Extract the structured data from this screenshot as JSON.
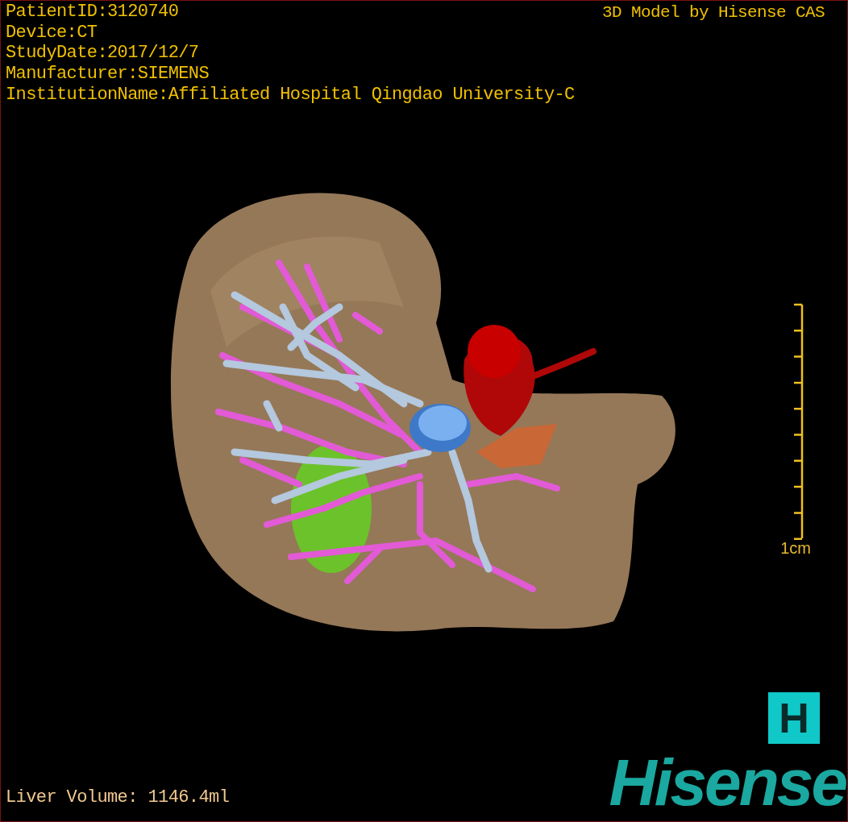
{
  "study_info": [
    "PatientID:3120740",
    "Device:CT",
    "StudyDate:2017/12/7",
    "Manufacturer:SIEMENS",
    "InstitutionName:Affiliated Hospital Qingdao University-C"
  ],
  "model_credit": "3D Model by Hisense CAS",
  "scale": {
    "label": "1cm"
  },
  "liver_volume": "Liver Volume: 1146.4ml",
  "logo": {
    "mark": "H",
    "wordmark": "Hisense"
  }
}
